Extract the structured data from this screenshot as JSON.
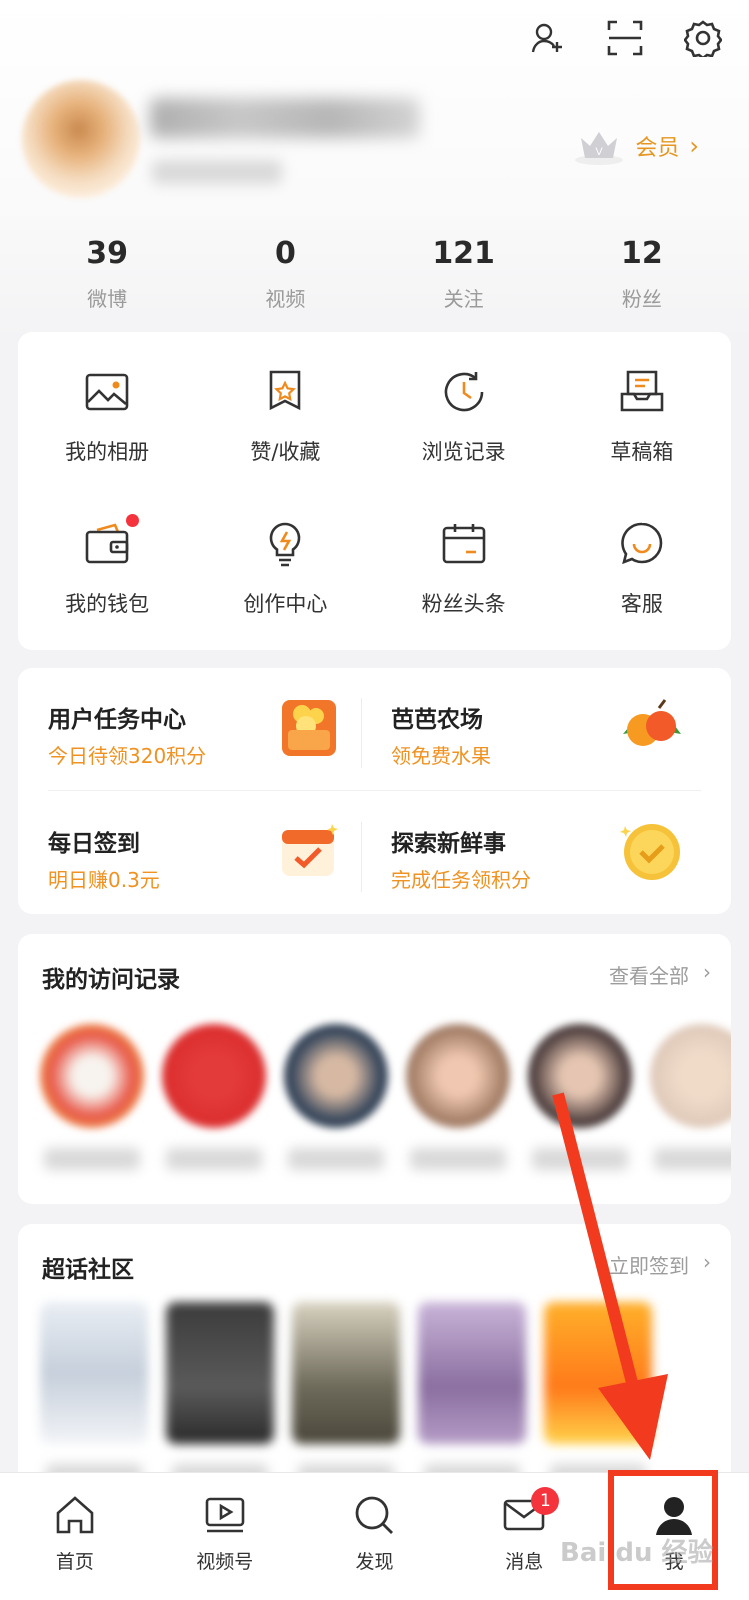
{
  "header": {
    "top_icons": [
      "add-friend-icon",
      "scan-icon",
      "settings-icon"
    ],
    "vip_label": "会员",
    "vip_chevron": "›"
  },
  "stats": [
    {
      "value": "39",
      "label": "微博"
    },
    {
      "value": "0",
      "label": "视频"
    },
    {
      "value": "121",
      "label": "关注"
    },
    {
      "value": "12",
      "label": "粉丝"
    }
  ],
  "tools": [
    {
      "label": "我的相册",
      "icon": "photo-album-icon"
    },
    {
      "label": "赞/收藏",
      "icon": "favorites-icon"
    },
    {
      "label": "浏览记录",
      "icon": "history-icon"
    },
    {
      "label": "草稿箱",
      "icon": "drafts-icon"
    },
    {
      "label": "我的钱包",
      "icon": "wallet-icon",
      "dot": true
    },
    {
      "label": "创作中心",
      "icon": "creator-center-icon"
    },
    {
      "label": "粉丝头条",
      "icon": "fans-headline-icon"
    },
    {
      "label": "客服",
      "icon": "customer-service-icon"
    }
  ],
  "tasks": [
    {
      "title": "用户任务中心",
      "subtitle": "今日待领320积分",
      "icon": "coins-icon"
    },
    {
      "title": "芭芭农场",
      "subtitle": "领免费水果",
      "icon": "fruit-icon"
    },
    {
      "title": "每日签到",
      "subtitle": "明日赚0.3元",
      "icon": "calendar-check-icon"
    },
    {
      "title": "探索新鲜事",
      "subtitle": "完成任务领积分",
      "icon": "gold-coin-icon"
    }
  ],
  "visits": {
    "title": "我的访问记录",
    "more_label": "查看全部",
    "chevron": "›"
  },
  "supertopic": {
    "title": "超话社区",
    "more_label": "立即签到",
    "chevron": "›"
  },
  "tabbar": [
    {
      "label": "首页",
      "icon": "home-icon"
    },
    {
      "label": "视频号",
      "icon": "video-icon"
    },
    {
      "label": "发现",
      "icon": "discover-icon"
    },
    {
      "label": "消息",
      "icon": "message-icon",
      "badge": "1"
    },
    {
      "label": "我",
      "icon": "profile-icon"
    }
  ],
  "watermark": "Bai du 经验",
  "colors": {
    "accent": "#e6961f",
    "badge": "#f4333c",
    "annotation": "#f23a1f"
  }
}
